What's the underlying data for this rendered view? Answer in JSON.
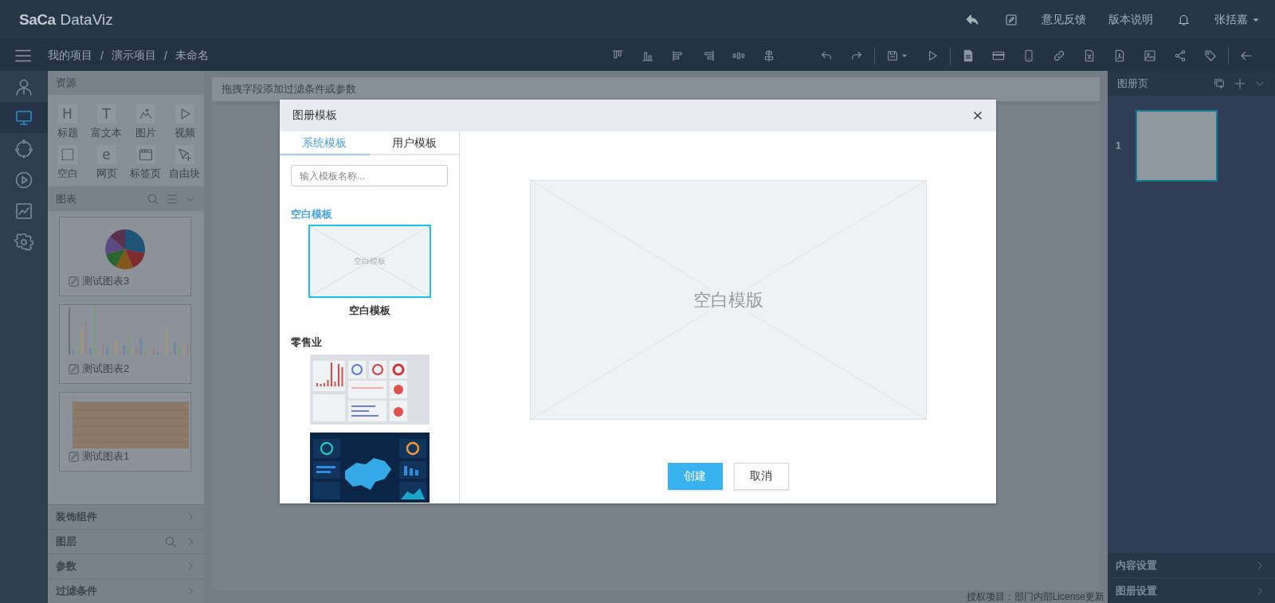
{
  "header": {
    "logo_brand": "SaCa",
    "logo_product": "DataViz",
    "links": [
      "意见反馈",
      "版本说明"
    ],
    "user": "张括嘉"
  },
  "breadcrumb": {
    "items": [
      "我的项目",
      "演示项目",
      "未命名"
    ],
    "separator": "/"
  },
  "rail": [
    {
      "selected": false
    },
    {
      "selected": true
    },
    {
      "selected": false
    },
    {
      "selected": false
    },
    {
      "selected": false
    },
    {
      "selected": false
    }
  ],
  "resources": {
    "title": "资源",
    "items": [
      {
        "label": "标题",
        "glyph": "H"
      },
      {
        "label": "富文本",
        "glyph": "T"
      },
      {
        "label": "图片"
      },
      {
        "label": "视频"
      },
      {
        "label": "空白"
      },
      {
        "label": "网页",
        "glyph": "e"
      },
      {
        "label": "标签页"
      },
      {
        "label": "自由块"
      }
    ]
  },
  "charts": {
    "title": "图表",
    "cards": [
      {
        "kind": "pie",
        "name": "测试图表3"
      },
      {
        "kind": "bar",
        "name": "测试图表2"
      },
      {
        "kind": "table",
        "name": "测试图表1"
      }
    ]
  },
  "accordion": [
    {
      "label": "装饰组件",
      "search": false
    },
    {
      "label": "图层",
      "search": true
    },
    {
      "label": "参数",
      "search": false
    },
    {
      "label": "过滤条件",
      "search": false
    }
  ],
  "filter_bar": {
    "hint": "拖拽字段添加过滤条件或参数"
  },
  "footer": "授权项目：部门内部License更新",
  "pages": {
    "title": "图册页",
    "items": [
      {
        "number": "1",
        "selected": true
      }
    ]
  },
  "settings": [
    "内容设置",
    "图册设置"
  ],
  "dialog": {
    "title": "图册模板",
    "tabs": [
      {
        "label": "系统模板",
        "selected": true
      },
      {
        "label": "用户模板",
        "selected": false
      }
    ],
    "search": {
      "placeholder": "输入模板名称..."
    },
    "sections": [
      {
        "title": "空白模板",
        "templates": [
          {
            "kind": "blank",
            "label": "空白模板",
            "caption": "空白模板",
            "selected": true
          }
        ]
      },
      {
        "title": "零售业",
        "templates": [
          {
            "kind": "light_dashboard",
            "selected": false
          },
          {
            "kind": "dark_dashboard",
            "selected": false
          }
        ]
      }
    ],
    "preview": {
      "label": "空白模版"
    },
    "buttons": [
      {
        "label": "创建",
        "kind": "primary"
      },
      {
        "label": "取消",
        "kind": "default"
      }
    ]
  }
}
